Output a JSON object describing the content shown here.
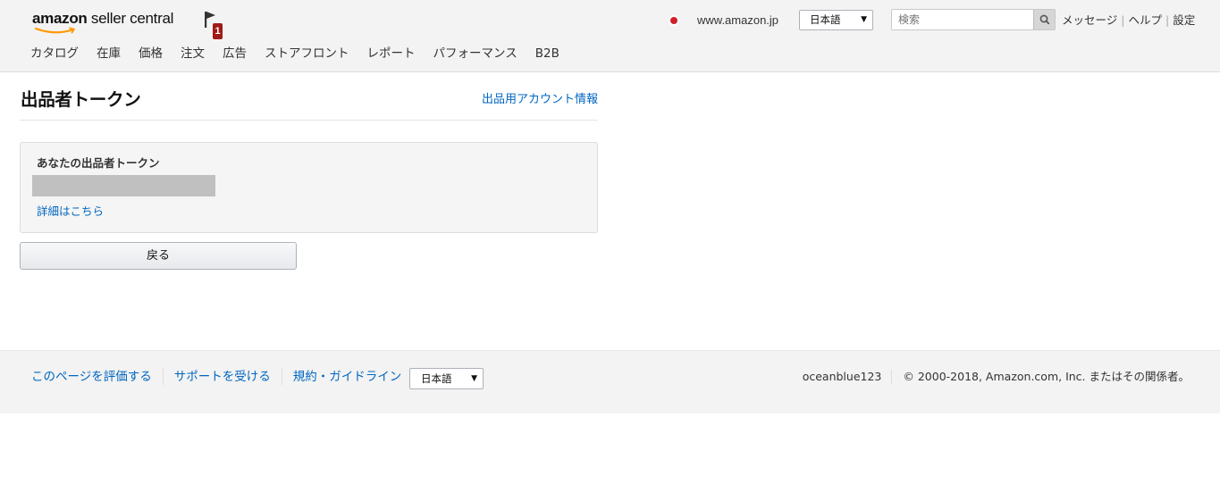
{
  "header": {
    "logo_text_bold": "amazon",
    "logo_text_regular": " seller central",
    "notification_count": "1",
    "nav_items": [
      "カタログ",
      "在庫",
      "価格",
      "注文",
      "広告",
      "ストアフロント",
      "レポート",
      "パフォーマンス",
      "B2B"
    ],
    "marketplace": "www.amazon.jp",
    "language_selected": "日本語",
    "search_placeholder": "検索",
    "top_links": [
      "メッセージ",
      "ヘルプ",
      "設定"
    ]
  },
  "main": {
    "title": "出品者トークン",
    "account_link": "出品用アカウント情報",
    "token_label": "あなたの出品者トークン",
    "learn_more": "詳細はこちら",
    "back_button": "戻る"
  },
  "footer": {
    "links": [
      "このページを評価する",
      "サポートを受ける",
      "規約・ガイドライン"
    ],
    "language_selected": "日本語",
    "username": "oceanblue123",
    "copyright": "© 2000-2018, Amazon.com, Inc. またはその関係者。"
  },
  "colors": {
    "link": "#0066c0",
    "header_bg": "#f3f3f3",
    "badge": "#a11a1a",
    "logo_smile": "#ff9900"
  }
}
